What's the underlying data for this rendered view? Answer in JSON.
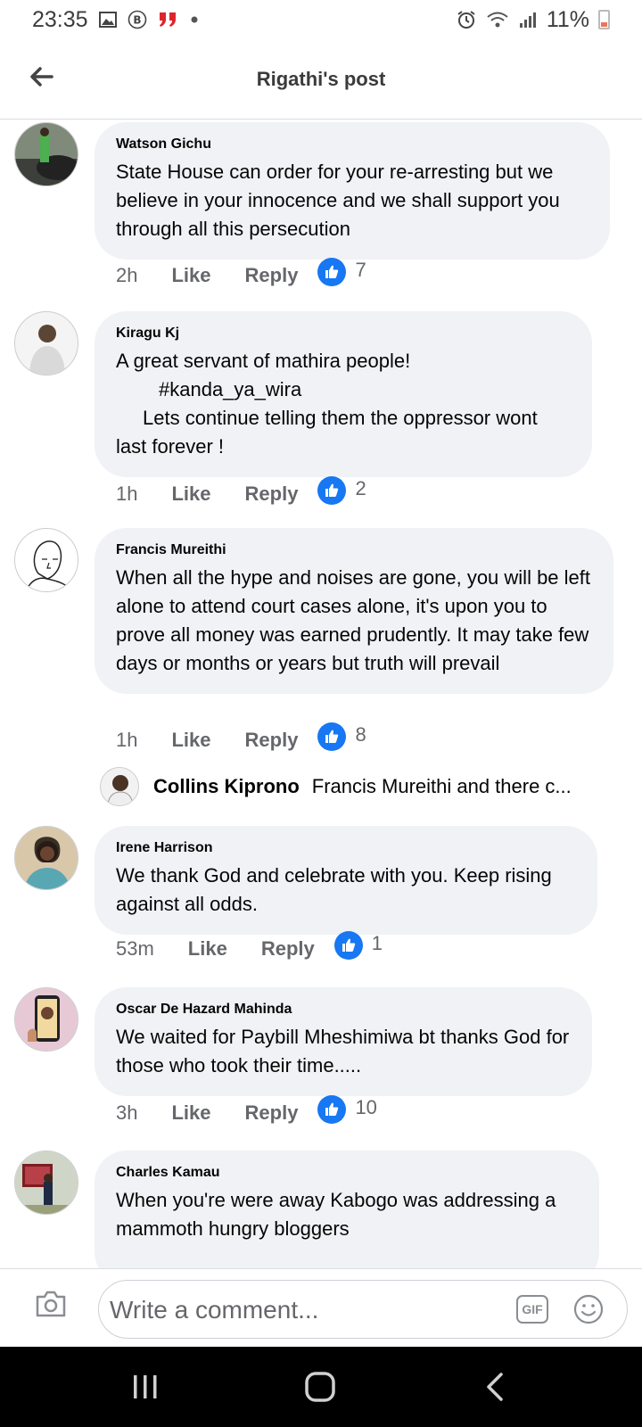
{
  "status_bar": {
    "time": "23:35",
    "battery": "11%"
  },
  "header": {
    "title": "Rigathi's post"
  },
  "comments": [
    {
      "author": "Watson Gichu",
      "text": "State House can order for your re-arresting but we believe in your innocence and we shall support you through all this persecution",
      "time": "2h",
      "like_label": "Like",
      "reply_label": "Reply",
      "reactions": "7"
    },
    {
      "author": "Kiragu Kj",
      "text_line1": "A great servant of mathira people!",
      "hashtag": "#kanda_ya_wira",
      "text_line3": "Lets continue telling them the oppressor wont last forever !",
      "time": "1h",
      "like_label": "Like",
      "reply_label": "Reply",
      "reactions": "2"
    },
    {
      "author": "Francis Mureithi",
      "text": "When all the hype and noises are gone, you will be left alone to attend court cases alone, it's upon you to prove all money was earned prudently. It may take few days or months or years but truth will prevail",
      "time": "1h",
      "like_label": "Like",
      "reply_label": "Reply",
      "reactions": "8",
      "reply_preview": {
        "author": "Collins Kiprono",
        "text": "Francis Mureithi and there c..."
      }
    },
    {
      "author": "Irene Harrison",
      "text": "We thank God and celebrate with you. Keep rising against all odds.",
      "time": "53m",
      "like_label": "Like",
      "reply_label": "Reply",
      "reactions": "1"
    },
    {
      "author": "Oscar De Hazard Mahinda",
      "text": "We waited for Paybill Mheshimiwa bt thanks God for those who took their time.....",
      "time": "3h",
      "like_label": "Like",
      "reply_label": "Reply",
      "reactions": "10"
    },
    {
      "author": "Charles Kamau",
      "text": "When you're were away Kabogo was addressing a mammoth hungry bloggers"
    }
  ],
  "comment_bar": {
    "placeholder": "Write a comment...",
    "gif_label": "GIF"
  },
  "colors": {
    "accent": "#1877f2",
    "bubble": "#f0f2f5",
    "secondary_text": "#65676b"
  },
  "icons": [
    "back-arrow-icon",
    "camera-icon",
    "gif-icon",
    "emoji-icon",
    "like-thumb-icon",
    "recent-apps-icon",
    "home-icon",
    "back-nav-icon"
  ]
}
